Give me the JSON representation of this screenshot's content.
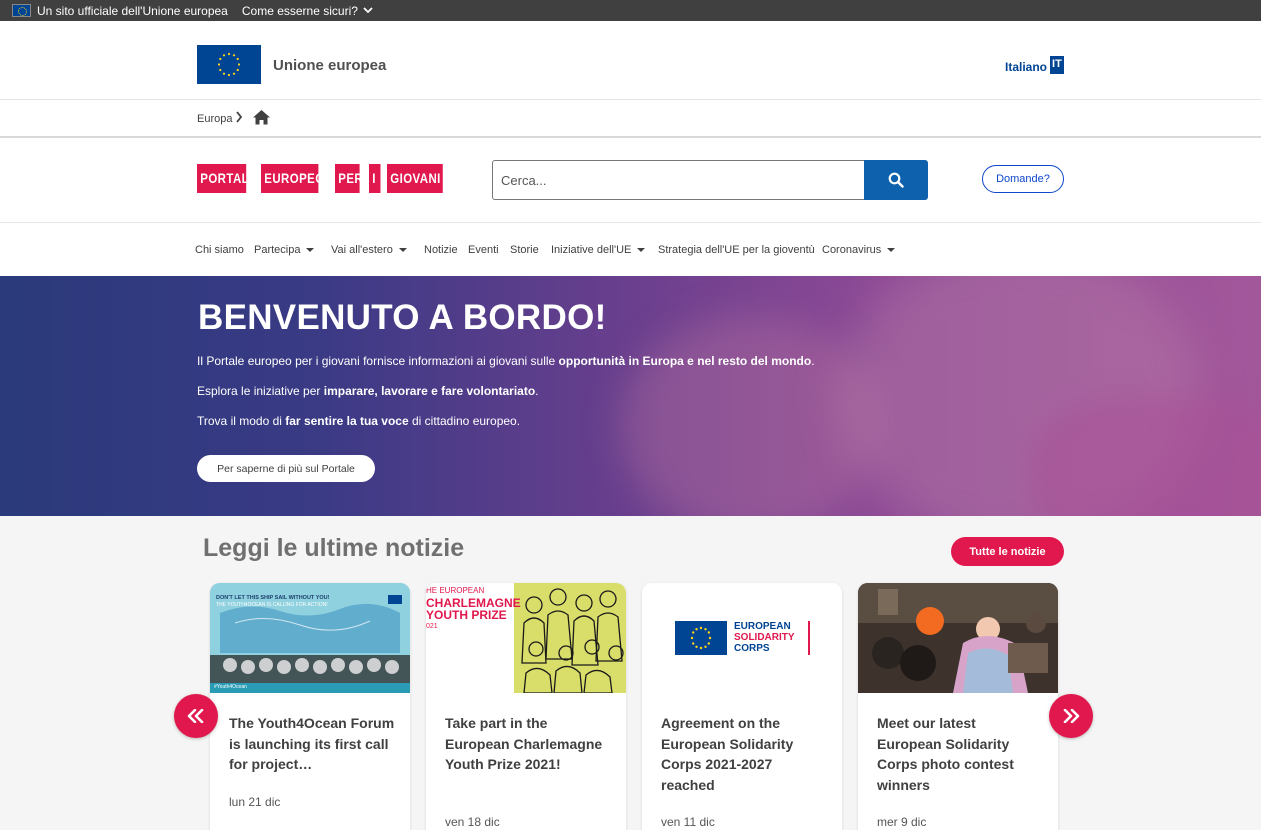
{
  "topbar": {
    "official": "Un sito ufficiale dell'Unione europea",
    "secure": "Come esserne sicuri?"
  },
  "eu_header": {
    "title": "Unione europea",
    "language": "Italiano",
    "language_code": "IT"
  },
  "breadcrumb": {
    "items": [
      "Europa"
    ],
    "home_icon": "home-icon"
  },
  "site": {
    "logo_words": [
      "PORTALE",
      "EUROPEO",
      "PER",
      "I",
      "GIOVANI"
    ],
    "search_placeholder": "Cerca...",
    "questions_label": "Domande?"
  },
  "nav": {
    "items": [
      {
        "label": "Chi siamo",
        "dropdown": false
      },
      {
        "label": "Partecipa",
        "dropdown": true
      },
      {
        "label": "Vai all'estero",
        "dropdown": true
      },
      {
        "label": "Notizie",
        "dropdown": false
      },
      {
        "label": "Eventi",
        "dropdown": false
      },
      {
        "label": "Storie",
        "dropdown": false
      },
      {
        "label": "Iniziative dell'UE",
        "dropdown": true
      },
      {
        "label": "Strategia dell'UE per la gioventù",
        "dropdown": false
      },
      {
        "label": "Coronavirus",
        "dropdown": true
      }
    ]
  },
  "hero": {
    "title": "BENVENUTO A BORDO!",
    "line1_a": "Il Portale europeo per i giovani fornisce informazioni ai giovani sulle ",
    "line1_b": "opportunità in Europa e nel resto del mondo",
    "line1_c": ".",
    "line2_a": "Esplora le iniziative per ",
    "line2_b": "imparare, lavorare e fare volontariato",
    "line2_c": ".",
    "line3_a": "Trova il modo di ",
    "line3_b": "far sentire la tua voce",
    "line3_c": " di cittadino europeo.",
    "cta": "Per saperne di più sul Portale"
  },
  "news": {
    "heading": "Leggi le ultime notizie",
    "all_label": "Tutte le notizie",
    "cards": [
      {
        "title": "The Youth4Ocean Forum is launching its first call for project…",
        "date": "lun 21 dic",
        "img_text_1": "DON'T LET THIS SHIP SAIL WITHOUT YOU!",
        "img_text_2": "THE YOUTH4OCEAN IS CALLING FOR ACTION!",
        "img_tag": "#Youth4Ocean"
      },
      {
        "title": "Take part in the European Charlemagne Youth Prize 2021!",
        "date": "ven 18 dic",
        "img_text_1": "HE EUROPEAN",
        "img_text_2": "CHARLEMAGNE",
        "img_text_3": "YOUTH PRIZE",
        "img_text_4": "021"
      },
      {
        "title": "Agreement on the European Solidarity Corps 2021-2027 reached",
        "date": "ven 11 dic",
        "img_text_1": "EUROPEAN",
        "img_text_2": "SOLIDARITY",
        "img_text_3": "CORPS"
      },
      {
        "title": "Meet our latest European Solidarity Corps photo contest winners",
        "date": "mer 9 dic"
      }
    ],
    "prev_icon": "double-chevron-left-icon",
    "next_icon": "double-chevron-right-icon"
  },
  "colors": {
    "accent_red": "#e0184d",
    "eu_blue": "#004494",
    "search_blue": "#0e62ad"
  }
}
